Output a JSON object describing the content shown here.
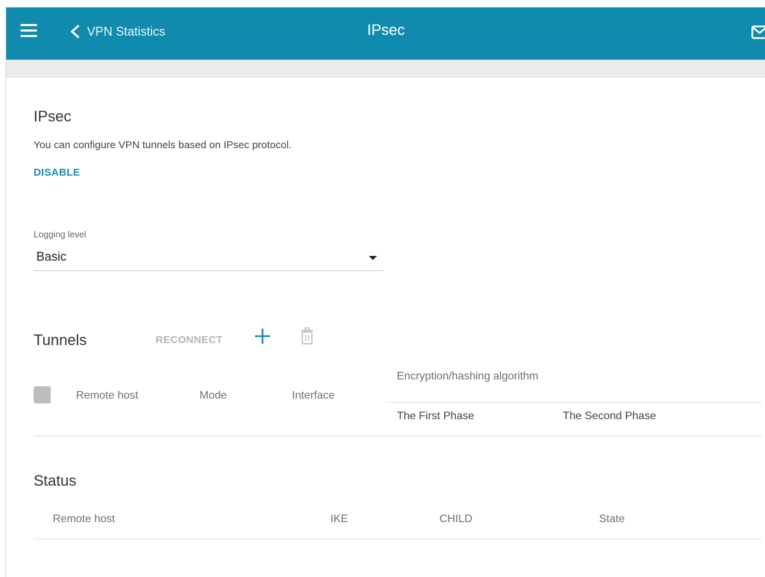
{
  "header": {
    "back_label": "VPN Statistics",
    "title": "IPsec",
    "menu_icon": "hamburger-menu-icon",
    "back_icon": "chevron-left-icon",
    "mail_icon": "envelope-icon"
  },
  "section": {
    "title": "IPsec",
    "description": "You can configure VPN tunnels based on IPsec protocol.",
    "disable_label": "DISABLE"
  },
  "logging": {
    "label": "Logging level",
    "value": "Basic"
  },
  "tunnels": {
    "title": "Tunnels",
    "reconnect_label": "RECONNECT",
    "add_icon": "plus-icon",
    "delete_icon": "trash-icon",
    "columns": {
      "remote_host": "Remote host",
      "mode": "Mode",
      "interface": "Interface",
      "encryption": "Encryption/hashing algorithm",
      "first_phase": "The First Phase",
      "second_phase": "The Second Phase"
    }
  },
  "status": {
    "title": "Status",
    "columns": [
      "Remote host",
      "IKE",
      "CHILD",
      "State"
    ]
  },
  "colors": {
    "header_bg": "#118bad",
    "accent": "#1a8cb0",
    "disabled": "#b4b4b4"
  }
}
